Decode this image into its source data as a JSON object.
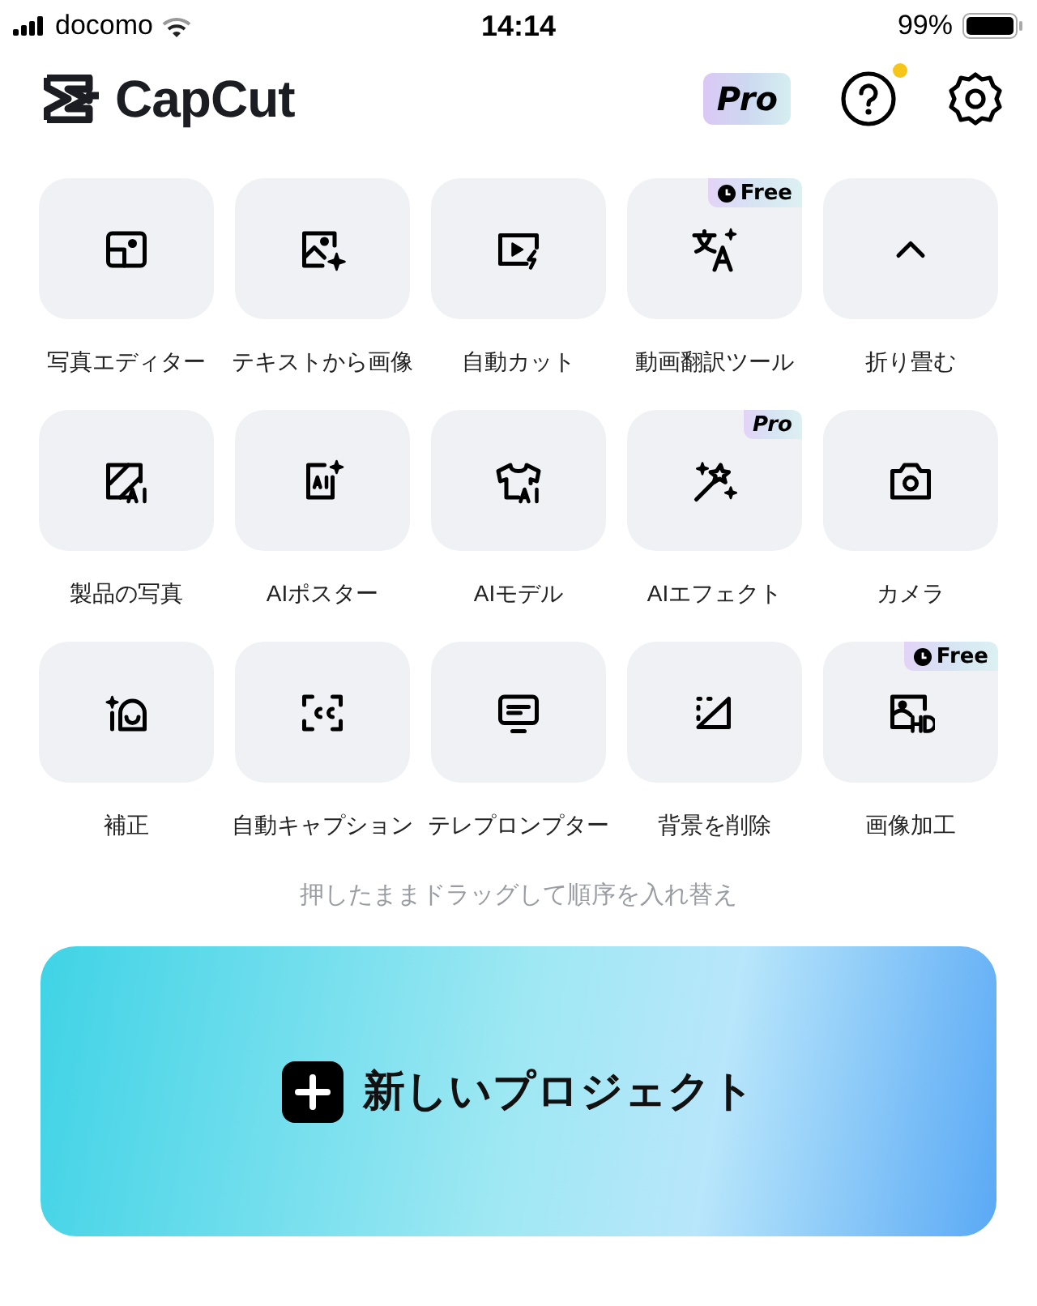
{
  "status_bar": {
    "carrier": "docomo",
    "time": "14:14",
    "battery": "99%"
  },
  "header": {
    "app_name": "CapCut",
    "pro_badge": "Pro",
    "help_notification": true
  },
  "tools": [
    {
      "label": "写真エディター"
    },
    {
      "label": "テキストから画像"
    },
    {
      "label": "自動カット"
    },
    {
      "label": "動画翻訳ツール",
      "badge": {
        "kind": "free",
        "text": "Free"
      }
    },
    {
      "label": "折り畳む"
    },
    {
      "label": "製品の写真"
    },
    {
      "label": "AIポスター"
    },
    {
      "label": "AIモデル"
    },
    {
      "label": "AIエフェクト",
      "badge": {
        "kind": "pro",
        "text": "Pro"
      }
    },
    {
      "label": "カメラ"
    },
    {
      "label": "補正"
    },
    {
      "label": "自動キャプション"
    },
    {
      "label": "テレプロンプター"
    },
    {
      "label": "背景を削除"
    },
    {
      "label": "画像加工",
      "badge": {
        "kind": "free",
        "text": "Free"
      }
    }
  ],
  "hint": "押したままドラッグして順序を入れ替え",
  "new_project": {
    "label": "新しいプロジェクト"
  }
}
